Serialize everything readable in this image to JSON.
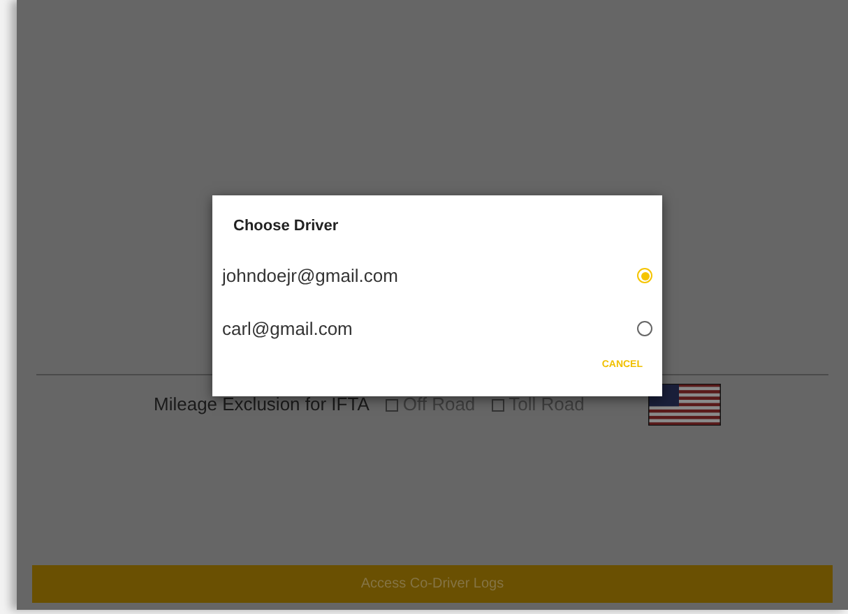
{
  "form": {
    "mileage_exclusion": {
      "label": "Mileage Exclusion for IFTA",
      "options": [
        {
          "label": "Off Road",
          "checked": false
        },
        {
          "label": "Toll Road",
          "checked": false
        }
      ]
    },
    "action_button": "Access Co-Driver Logs"
  },
  "dialog": {
    "title": "Choose Driver",
    "options": [
      {
        "label": "johndoejr@gmail.com",
        "selected": true
      },
      {
        "label": "carl@gmail.com",
        "selected": false
      }
    ],
    "cancel": "CANCEL"
  }
}
